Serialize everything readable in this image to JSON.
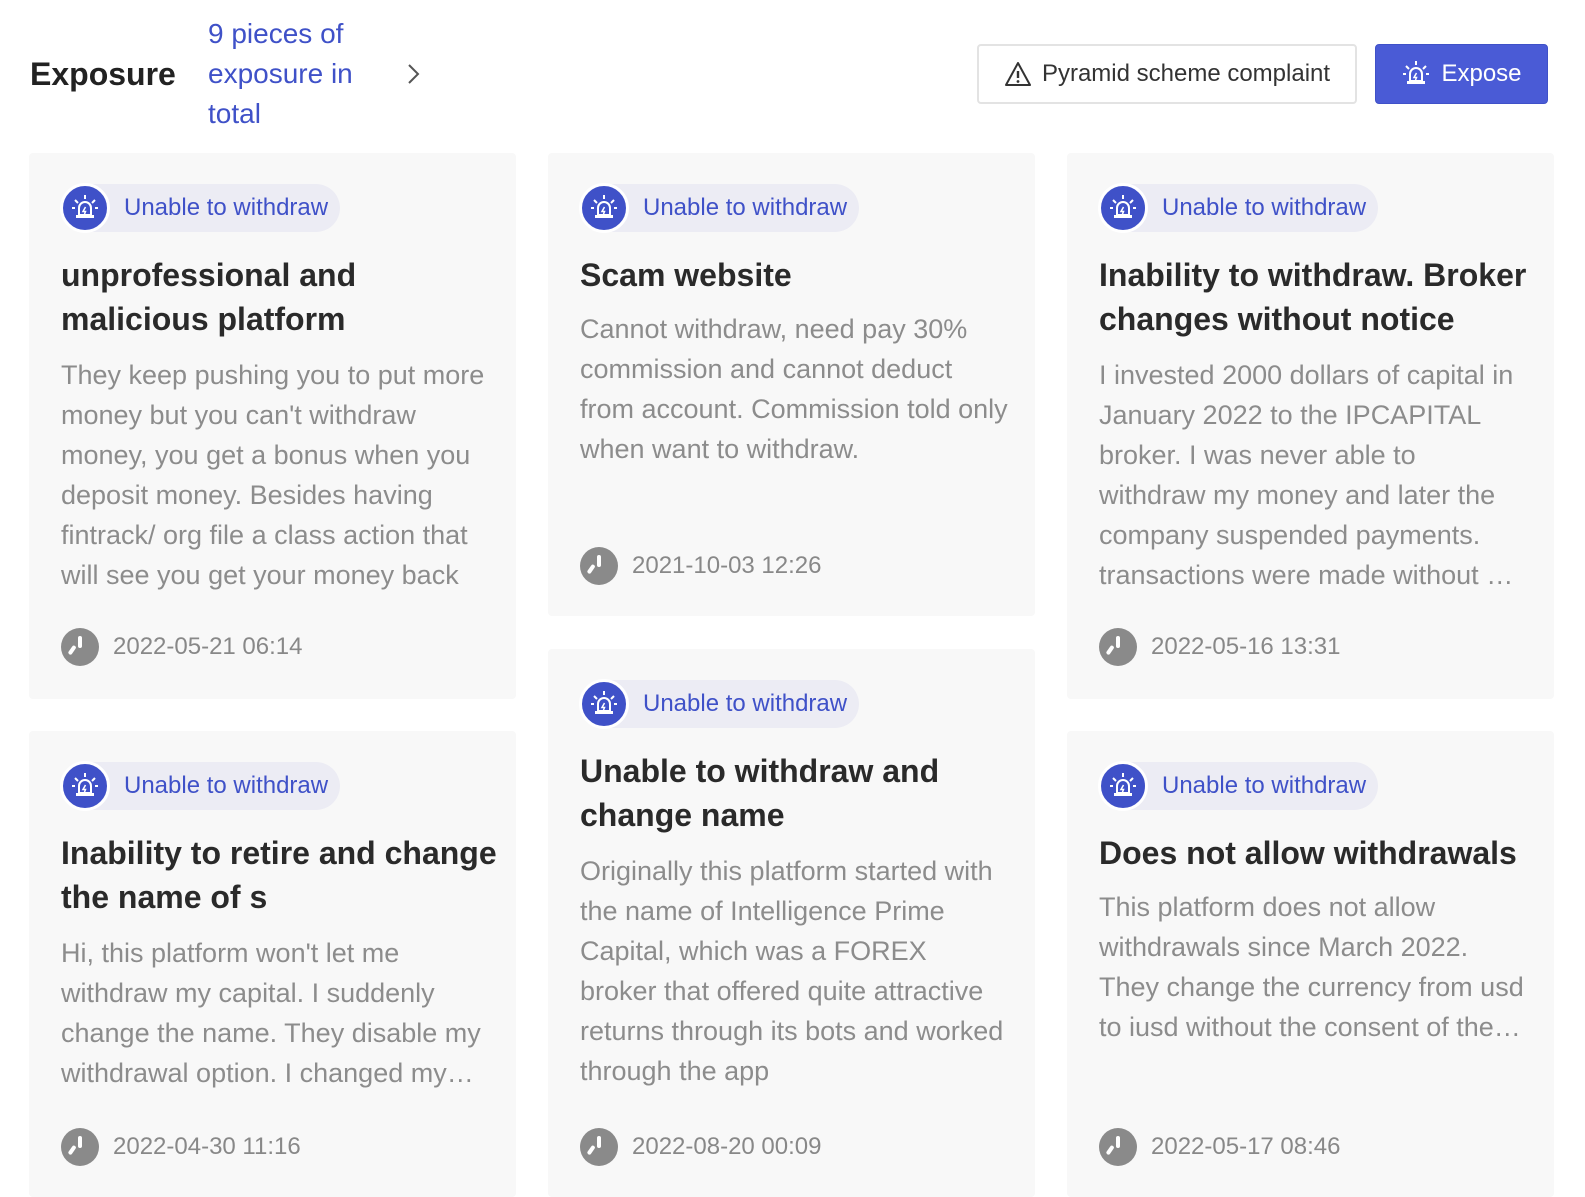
{
  "header": {
    "title": "Exposure",
    "count_text": "9 pieces of exposure in total",
    "complaint_button": "Pyramid scheme complaint",
    "expose_button": "Expose",
    "icons": {
      "count_link": "chevron-right-icon",
      "complaint": "warning-triangle-icon",
      "expose": "alarm-light-icon"
    }
  },
  "cards": [
    {
      "tag": "Unable to withdraw",
      "title": "unprofessional and malicious platform",
      "description": "They keep pushing you to put more money but you can't withdraw money, you get a bonus when you deposit money. Besides having fintrack/ org file a class action that will see you get your money back",
      "time": "2022-05-21 06:14"
    },
    {
      "tag": "Unable to withdraw",
      "title": "Scam website",
      "description": "Cannot withdraw, need pay 30% commission and cannot deduct from account.  Commission told only when want to withdraw.",
      "time": "2021-10-03 12:26"
    },
    {
      "tag": "Unable to withdraw",
      "title": "Inability to withdraw. Broker changes without notice",
      "description": "I invested 2000 dollars of capital in January 2022 to the IPCAPITAL broker. I was never able to withdraw my money and later the company suspended payments. transactions were made without my consent",
      "time": "2022-05-16 13:31"
    },
    {
      "tag": "Unable to withdraw",
      "title": "Inability to retire and change the name of s",
      "description": "Hi, this platform won't let me withdraw my capital. I suddenly change the name. They disable my withdrawal option. I changed my password without notice",
      "time": "2022-04-30 11:16"
    },
    {
      "tag": "Unable to withdraw",
      "title": "Unable to withdraw and change name",
      "description": "Originally this platform started with the name of Intelligence Prime Capital, which was a FOREX broker that offered quite attractive returns through its bots and worked through the app",
      "time": "2022-08-20 00:09"
    },
    {
      "tag": "Unable to withdraw",
      "title": "Does not allow withdrawals",
      "description": "This platform does not allow withdrawals since March 2022. They change the currency from usd to iusd without the consent of the user",
      "time": "2022-05-17 08:46"
    }
  ],
  "card_icons": {
    "tag": "alarm-light-icon",
    "time": "clock-icon"
  }
}
